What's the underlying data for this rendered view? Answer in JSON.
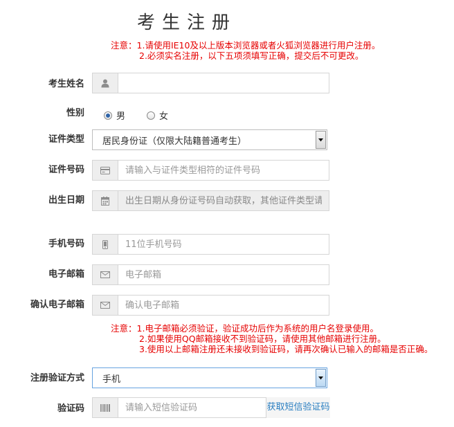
{
  "title": "考生注册",
  "notice_top": {
    "label": "注意：",
    "lines": [
      "1.请使用IE10及以上版本浏览器或者火狐浏览器进行用户注册。",
      "2.必须实名注册，以下五项须填写正确，提交后不可更改。"
    ]
  },
  "form": {
    "name": {
      "label": "考生姓名",
      "icon": "user-icon",
      "value": "",
      "placeholder": ""
    },
    "gender": {
      "label": "性别",
      "options": [
        "男",
        "女"
      ],
      "selected": "男"
    },
    "id_type": {
      "label": "证件类型",
      "value": "居民身份证（仅限大陆籍普通考生）"
    },
    "id_number": {
      "label": "证件号码",
      "icon": "id-card-icon",
      "placeholder": "请输入与证件类型相符的证件号码"
    },
    "birth_date": {
      "label": "出生日期",
      "icon": "calendar-icon",
      "placeholder": "出生日期从身份证号码自动获取，其他证件类型请输"
    },
    "phone": {
      "label": "手机号码",
      "icon": "mobile-icon",
      "placeholder": "11位手机号码"
    },
    "email": {
      "label": "电子邮箱",
      "icon": "envelope-icon",
      "placeholder": "电子邮箱"
    },
    "email_confirm": {
      "label": "确认电子邮箱",
      "icon": "envelope-icon",
      "placeholder": "确认电子邮箱"
    },
    "verify_method": {
      "label": "注册验证方式",
      "value": "手机"
    },
    "verify_code": {
      "label": "验证码",
      "icon": "barcode-icon",
      "placeholder": "请输入短信验证码",
      "link": "获取短信验证码"
    }
  },
  "notice_bottom": {
    "label": "注意：",
    "lines": [
      "1.电子邮箱必须验证，验证成功后作为系统的用户名登录使用。",
      "2.如果使用QQ邮箱接收不到验证码，请使用其他邮箱进行注册。",
      "3.使用以上邮箱注册还未接收到验证码，请再次确认已输入的邮箱是否正确。"
    ]
  },
  "colors": {
    "notice": "#e60000",
    "link": "#2a7fc1",
    "addon": "#eeeeee",
    "focus_border": "#66a3e0"
  }
}
